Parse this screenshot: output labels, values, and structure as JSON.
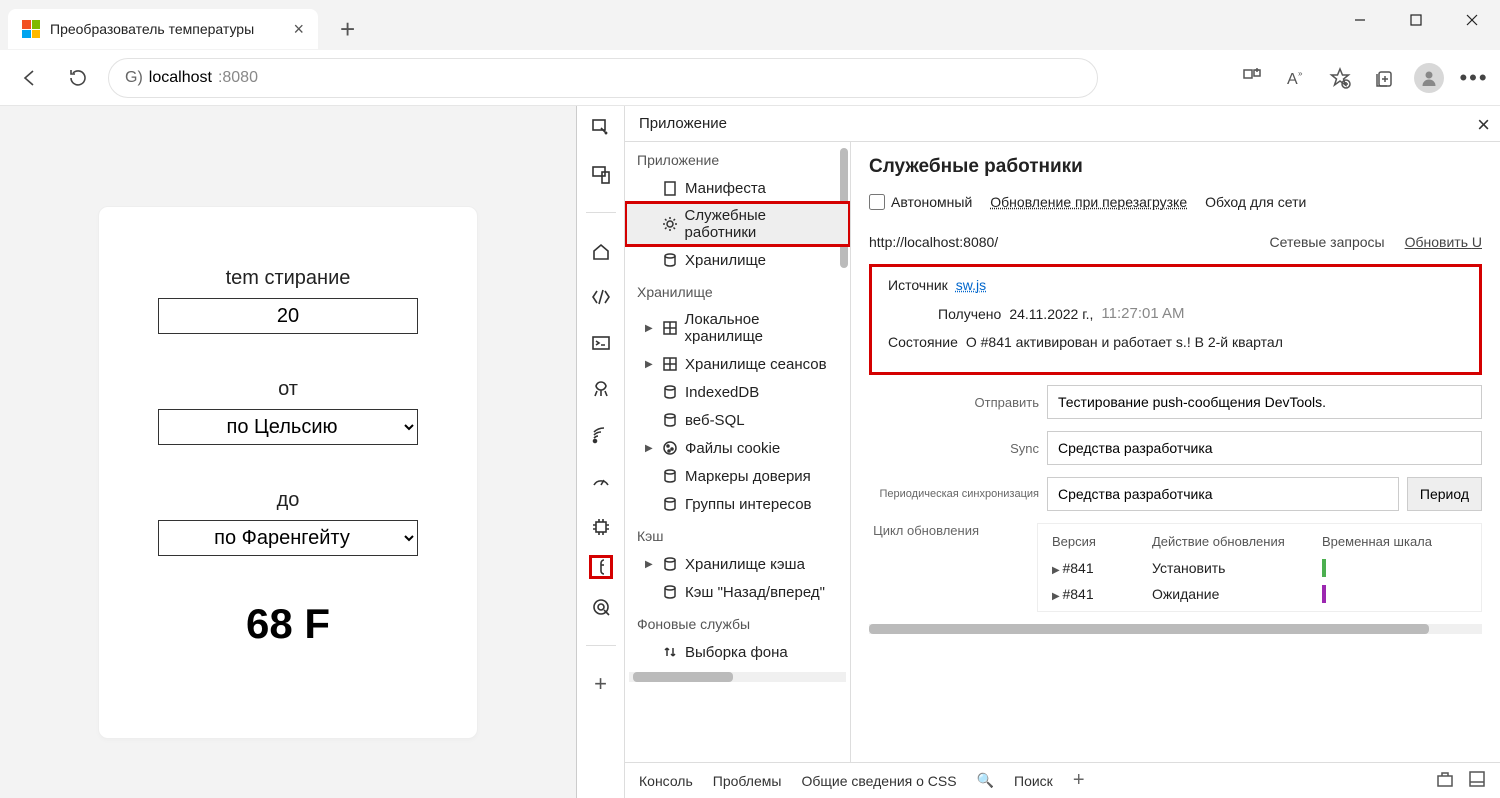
{
  "browser": {
    "tab_title": "Преобразователь температуры",
    "url_prefix": "G)",
    "url_host": "localhost",
    "url_port": ":8080"
  },
  "page_app": {
    "temp_label": "tem стирание",
    "temp_value": "20",
    "from_label": "от",
    "from_value": "по Цельсию",
    "to_label": "до",
    "to_value": "по Фаренгейту",
    "result": "68 F"
  },
  "devtools": {
    "panel_title": "Приложение",
    "tree": {
      "sections": [
        {
          "title": "Приложение",
          "items": [
            {
              "label": "Манифеста",
              "icon": "doc"
            },
            {
              "label": "Служебные работники",
              "icon": "gear",
              "selected": true,
              "highlight": true
            },
            {
              "label": "Хранилище",
              "icon": "db"
            }
          ]
        },
        {
          "title": "Хранилище",
          "items": [
            {
              "label": "Локальное хранилище",
              "icon": "grid",
              "expandable": true
            },
            {
              "label": "Хранилище сеансов",
              "icon": "grid",
              "expandable": true
            },
            {
              "label": "IndexedDB",
              "icon": "db"
            },
            {
              "label": "веб-SQL",
              "icon": "db"
            },
            {
              "label": "Файлы cookie",
              "icon": "cookie",
              "expandable": true
            },
            {
              "label": "Маркеры доверия",
              "icon": "db"
            },
            {
              "label": "Группы интересов",
              "icon": "db"
            }
          ]
        },
        {
          "title": "Кэш",
          "items": [
            {
              "label": "Хранилище кэша",
              "icon": "db",
              "expandable": true
            },
            {
              "label": "Кэш \"Назад/вперед\"",
              "icon": "db"
            }
          ]
        },
        {
          "title": "Фоновые службы",
          "items": [
            {
              "label": "Выборка фона",
              "icon": "updown"
            }
          ]
        }
      ]
    },
    "details": {
      "heading": "Служебные работники",
      "checkboxes": {
        "offline": "Автономный",
        "update_reload": "Обновление при перезагрузке",
        "bypass": "Обход для сети"
      },
      "origin": "http://localhost:8080/",
      "network_requests": "Сетевые запросы",
      "refresh": "Обновить",
      "refresh_shortcut": "U",
      "source_label": "Источник",
      "source_link": "sw.js",
      "received_label": "Получено",
      "received_date": "24.11.2022 г.,",
      "received_time": "11:27:01 AM",
      "status_label": "Состояние",
      "status_text": "О #841 активирован и работает s.! В 2-й квартал",
      "send_label": "Отправить",
      "send_value": "Тестирование push-сообщения DevTools.",
      "sync_label": "Sync",
      "sync_value": "Средства разработчика",
      "periodic_label": "Периодическая синхронизация",
      "periodic_value": "Средства разработчика",
      "period_btn": "Период",
      "update_cycle_label": "Цикл обновления",
      "table": {
        "headers": [
          "Версия",
          "Действие обновления",
          "Временная шкала"
        ],
        "rows": [
          {
            "version": "#841",
            "action": "Установить",
            "color": "green"
          },
          {
            "version": "#841",
            "action": "Ожидание",
            "color": "purple"
          }
        ]
      }
    },
    "footer": {
      "console": "Консоль",
      "issues": "Проблемы",
      "css_overview": "Общие сведения о CSS",
      "search": "Поиск"
    }
  }
}
